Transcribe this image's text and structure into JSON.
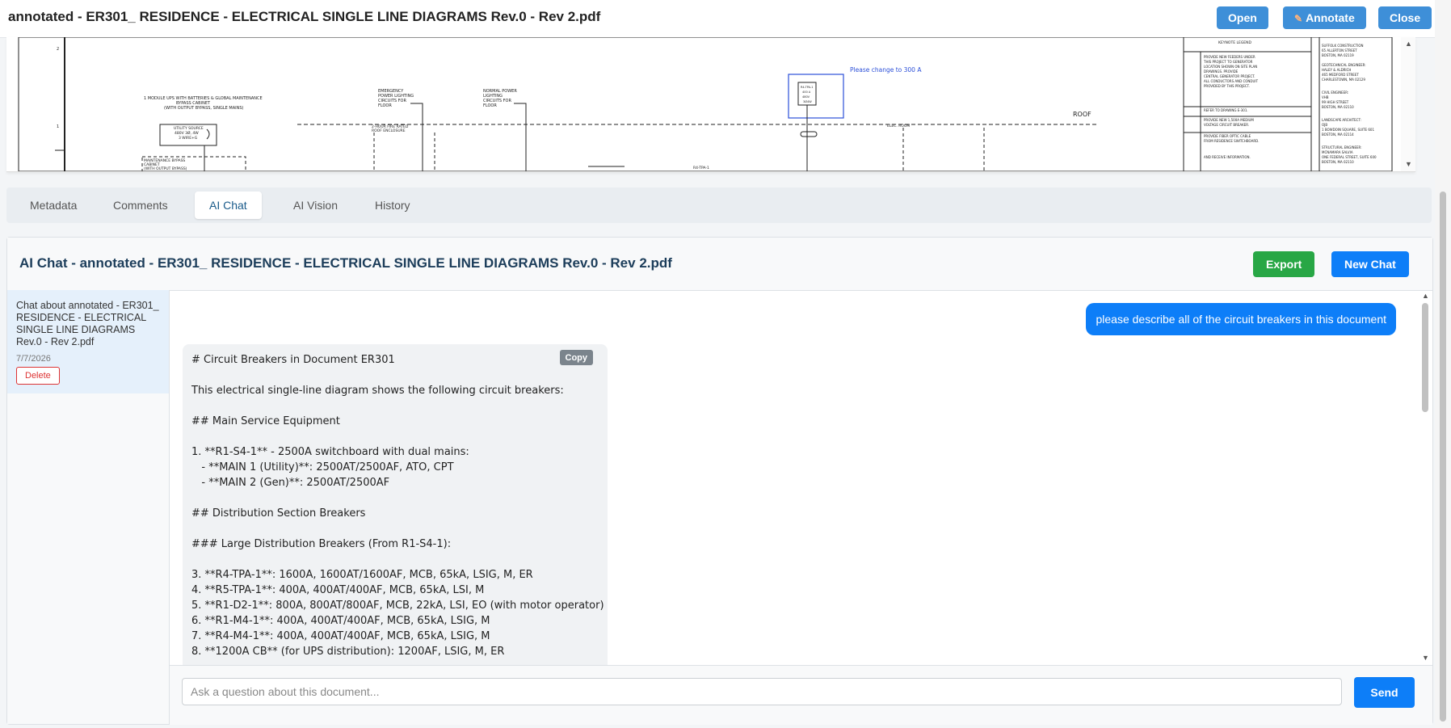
{
  "header": {
    "title": "annotated - ER301_ RESIDENCE - ELECTRICAL SINGLE LINE DIAGRAMS Rev.0 - Rev 2.pdf",
    "open_label": "Open",
    "annotate_label": "Annotate",
    "close_label": "Close"
  },
  "preview": {
    "annotation_note": "Please change to 300 A",
    "roof_label": "ROOF"
  },
  "tabs": [
    "Metadata",
    "Comments",
    "AI Chat",
    "AI Vision",
    "History"
  ],
  "active_tab": "AI Chat",
  "chat": {
    "title": "AI Chat - annotated - ER301_ RESIDENCE - ELECTRICAL SINGLE LINE DIAGRAMS Rev.0 - Rev 2.pdf",
    "export_label": "Export",
    "new_chat_label": "New Chat",
    "sessions": [
      {
        "title": "Chat about annotated - ER301_ RESIDENCE - ELECTRICAL SINGLE LINE DIAGRAMS Rev.0 - Rev 2.pdf",
        "date": "7/7/2026",
        "delete_label": "Delete"
      }
    ],
    "messages": {
      "user": "please describe all of the circuit breakers in this document",
      "ai_copy_label": "Copy",
      "ai_lines": [
        "# Circuit Breakers in Document ER301",
        "",
        "This electrical single-line diagram shows the following circuit breakers:",
        "",
        "## Main Service Equipment",
        "",
        "1. **R1-S4-1** - 2500A switchboard with dual mains:",
        "   - **MAIN 1 (Utility)**: 2500AT/2500AF, ATO, CPT",
        "   - **MAIN 2 (Gen)**: 2500AT/2500AF",
        "",
        "## Distribution Section Breakers",
        "",
        "### Large Distribution Breakers (From R1-S4-1):",
        "",
        "3. **R4-TPA-1**: 1600A, 1600AT/1600AF, MCB, 65kA, LSIG, M, ER",
        "4. **R5-TPA-1**: 400A, 400AT/400AF, MCB, 65kA, LSI, M",
        "5. **R1-D2-1**: 800A, 800AT/800AF, MCB, 22kA, LSI, EO (with motor operator)",
        "6. **R1-M4-1**: 400A, 400AT/400AF, MCB, 65kA, LSIG, M",
        "7. **R4-M4-1**: 400A, 400AT/400AF, MCB, 65kA, LSIG, M",
        "8. **1200A CB** (for UPS distribution): 1200AF, LSIG, M, ER"
      ]
    },
    "input_placeholder": "Ask a question about this document...",
    "send_label": "Send"
  },
  "icons": {
    "annotate": "pencil-icon",
    "scroll_up": "chevron-up-icon",
    "scroll_down": "chevron-down-icon"
  },
  "colors": {
    "primary": "#0d7ef8",
    "toolbar_button": "#3e8fd8",
    "export": "#28a745",
    "delete": "#dd3333",
    "title": "#1c3d5a"
  }
}
